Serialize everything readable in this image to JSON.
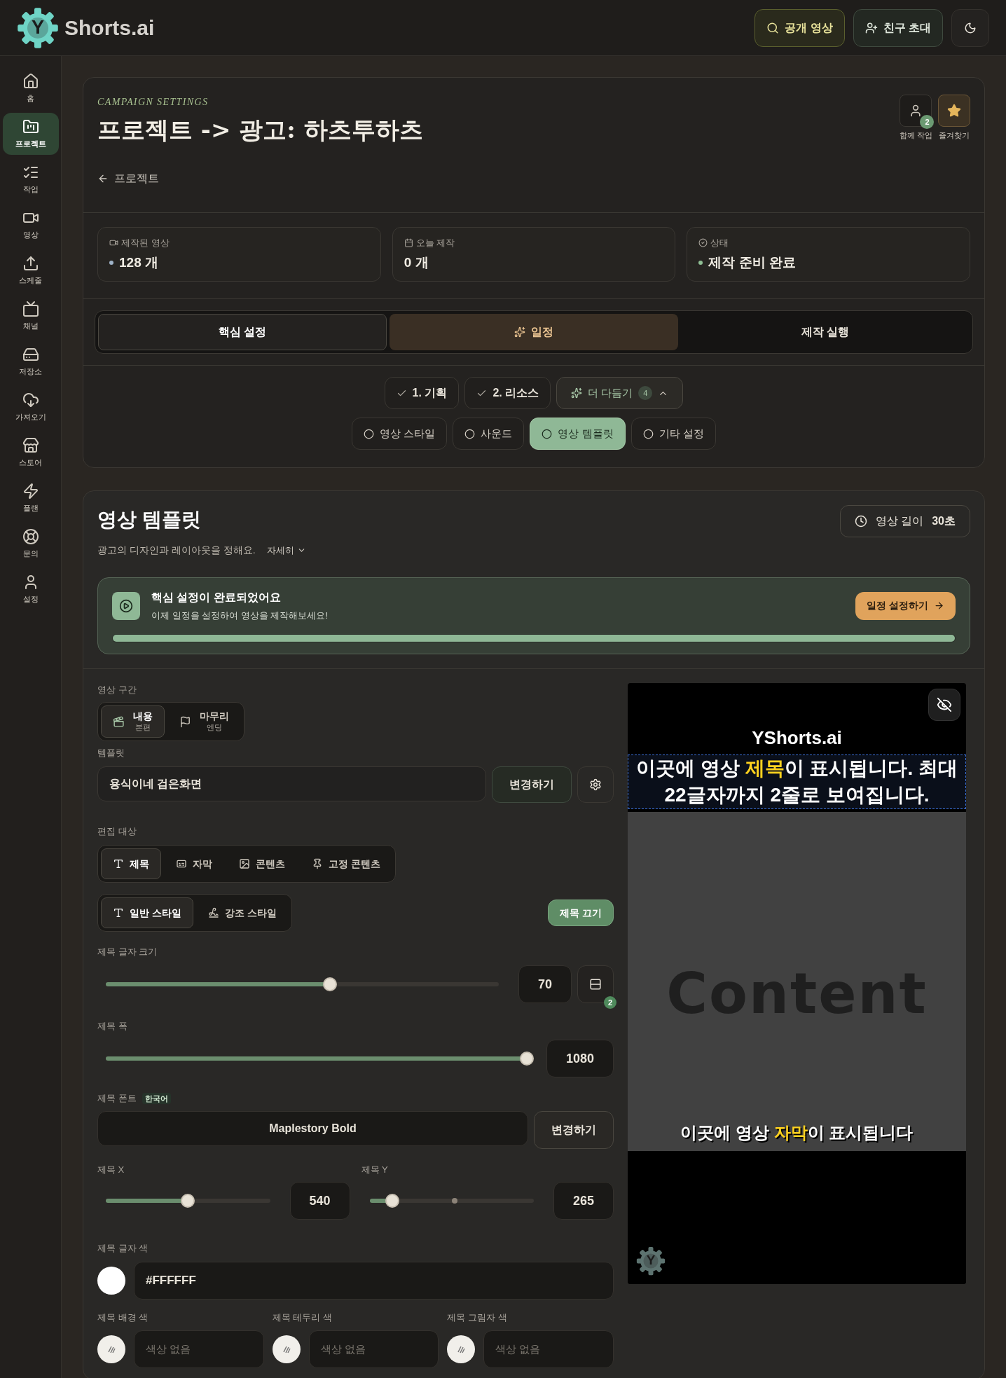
{
  "header": {
    "logo_mark": "Y",
    "brand": "Shorts.ai",
    "buttons": [
      {
        "kind": "search",
        "label": "공개 영상"
      },
      {
        "kind": "invite",
        "label": "친구 초대"
      }
    ]
  },
  "sidebar": {
    "items": [
      {
        "kind": "home",
        "label": "홈",
        "selected": false
      },
      {
        "kind": "project",
        "label": "프로젝트",
        "selected": true
      },
      {
        "kind": "tasks",
        "label": "작업",
        "selected": false
      },
      {
        "kind": "video",
        "label": "영상",
        "selected": false
      },
      {
        "kind": "upload",
        "label": "스케줄",
        "selected": false
      },
      {
        "kind": "tv",
        "label": "채널",
        "selected": false
      },
      {
        "kind": "storage",
        "label": "저장소",
        "selected": false
      },
      {
        "kind": "import",
        "label": "가져오기",
        "selected": false
      },
      {
        "kind": "store",
        "label": "스토어",
        "selected": false
      },
      {
        "kind": "plan",
        "label": "플랜",
        "selected": false
      },
      {
        "kind": "help",
        "label": "문의",
        "selected": false
      },
      {
        "kind": "user",
        "label": "설정",
        "selected": false
      }
    ]
  },
  "campaign": {
    "eyebrow": "CAMPAIGN SETTINGS",
    "title": "프로젝트 -> 광고: 하츠투하츠",
    "actions": [
      {
        "kind": "collab",
        "label": "함께 작업",
        "badge": "2"
      },
      {
        "kind": "favorite",
        "label": "즐겨찾기"
      }
    ],
    "back_link": "프로젝트",
    "stats": [
      {
        "kind": "video",
        "label": "제작된 영상",
        "value": "128 개",
        "color": "#9fb3c8"
      },
      {
        "kind": "calendar",
        "label": "오늘 제작",
        "value": "0 개"
      },
      {
        "kind": "status",
        "label": "상태",
        "value": "제작 준비 완료",
        "color": "#8fbf94"
      }
    ],
    "tabs": [
      {
        "label": "핵심 설정",
        "selected": false,
        "completed": true
      },
      {
        "label": "일정",
        "selected": true,
        "completed": false
      },
      {
        "label": "제작 실행",
        "selected": false,
        "completed": false
      }
    ],
    "steps": [
      {
        "kind": "done",
        "label": "1. 기획"
      },
      {
        "kind": "done",
        "label": "2. 리소스"
      },
      {
        "kind": "group",
        "label": "더 다듬기",
        "count": "4",
        "expanded": true
      }
    ],
    "substeps": [
      {
        "label": "영상 스타일",
        "selected": false
      },
      {
        "label": "사운드",
        "selected": false
      },
      {
        "label": "영상 템플릿",
        "selected": true
      },
      {
        "label": "기타 설정",
        "selected": false
      }
    ]
  },
  "template_section": {
    "title": "영상 템플릿",
    "duration_label": "영상 길이",
    "duration_value": "30초",
    "description": "광고의 디자인과 레이아웃을 정해요.",
    "more_link": "자세히",
    "banner": {
      "title": "핵심 설정이 완료되었어요",
      "subtitle": "이제 일정을 설정하여 영상을 제작해보세요!",
      "button": "일정 설정하기",
      "level": 1
    },
    "segment": {
      "label": "영상 구간",
      "options": [
        {
          "kind": "content",
          "label": "내용",
          "sublabel": "본편",
          "selected": true
        },
        {
          "kind": "ending",
          "label": "마무리",
          "sublabel": "엔딩",
          "selected": false
        }
      ]
    },
    "template": {
      "label": "템플릿",
      "value": "용식이네 검은화면",
      "button": "변경하기"
    },
    "edit_target": {
      "label": "편집 대상",
      "options": [
        {
          "kind": "title",
          "label": "제목",
          "selected": true
        },
        {
          "kind": "caption",
          "label": "자막",
          "selected": false
        },
        {
          "kind": "image",
          "label": "콘텐츠",
          "selected": false
        },
        {
          "kind": "pin",
          "label": "고정 콘텐츠",
          "selected": false
        }
      ]
    },
    "style": {
      "options": [
        {
          "kind": "title",
          "label": "일반 스타일",
          "selected": true
        },
        {
          "kind": "emphasis",
          "label": "강조 스타일",
          "selected": false
        }
      ],
      "toggle_button": "제목 끄기"
    },
    "font_size": {
      "label": "제목 글자 크기",
      "value": "70",
      "level": 0.57,
      "badge": "2"
    },
    "width": {
      "label": "제목 폭",
      "value": "1080",
      "level": 1
    },
    "font": {
      "label": "제목 폰트",
      "tag": "한국어",
      "value": "Maplestory Bold",
      "button": "변경하기"
    },
    "pos_x": {
      "label": "제목 X",
      "value": "540",
      "level": 0.5
    },
    "pos_y": {
      "label": "제목 Y",
      "value": "265",
      "level": 0.14
    },
    "text_color": {
      "label": "제목 글자 색",
      "value": "#FFFFFF"
    },
    "other_colors": [
      {
        "label": "제목 배경 색",
        "placeholder": "색상 없음"
      },
      {
        "label": "제목 테두리 색",
        "placeholder": "색상 없음"
      },
      {
        "label": "제목 그림자 색",
        "placeholder": "색상 없음"
      }
    ]
  },
  "preview": {
    "brand": "YShorts.ai",
    "title": {
      "before": "이곳에 영상 ",
      "highlight": "제목",
      "after": "이 표시됩니다. 최대 22글자까지 2줄로 보여집니다."
    },
    "content": "Content",
    "subtitle": {
      "before": "이곳에 영상 ",
      "highlight": "자막",
      "after": "이 표시됩니다"
    },
    "logo_mark": "Y"
  }
}
